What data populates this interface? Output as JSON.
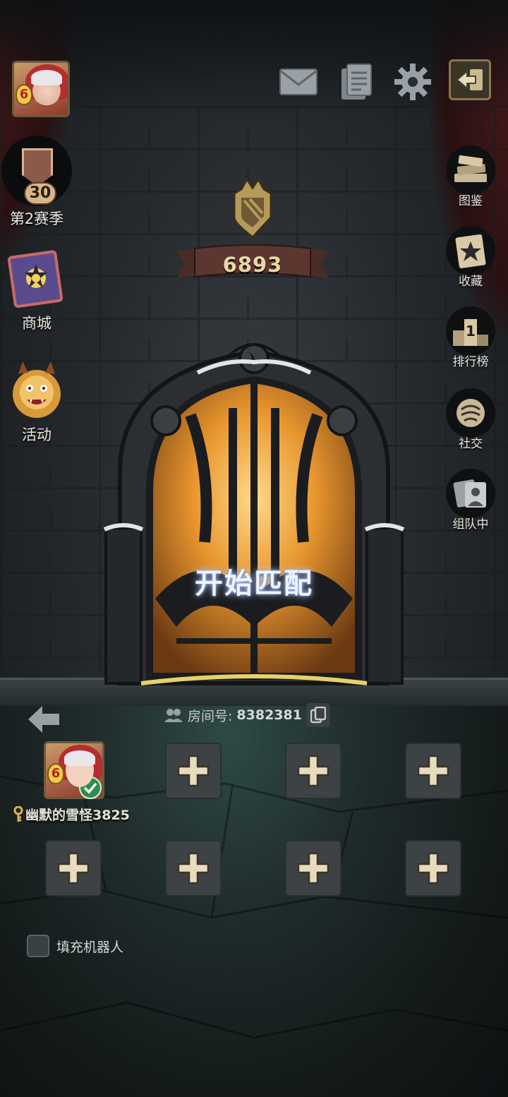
{
  "header": {
    "player_level": "6",
    "icons": [
      "mail-icon",
      "notes-icon",
      "gear-icon",
      "exit-icon"
    ]
  },
  "left_menu": {
    "season_number": "30",
    "season_label": "第2赛季",
    "shop_label": "商城",
    "event_label": "活动"
  },
  "right_menu": {
    "items": [
      {
        "label": "图鉴",
        "icon": "books-icon"
      },
      {
        "label": "收藏",
        "icon": "star-card-icon"
      },
      {
        "label": "排行榜",
        "icon": "podium-icon"
      },
      {
        "label": "社交",
        "icon": "fist-icon"
      },
      {
        "label": "组队中",
        "icon": "team-icon"
      }
    ]
  },
  "rank": {
    "score": "6893"
  },
  "door": {
    "start_label": "开始匹配"
  },
  "room": {
    "label": "房间号:",
    "number": "8382381"
  },
  "party": {
    "player_name": "幽默的雪怪3825",
    "player_level": "6",
    "empty_slots": 7
  },
  "options": {
    "fill_bots_label": "填充机器人",
    "fill_bots_checked": false
  },
  "colors": {
    "accent_gold": "#e9d6a8",
    "slot_bg": "#3d4245",
    "check_green": "#2f8c4e"
  }
}
